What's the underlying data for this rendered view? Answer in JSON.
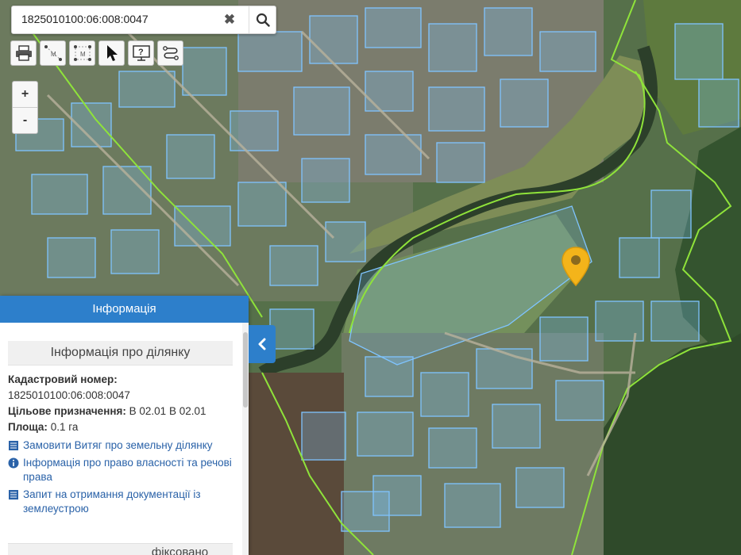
{
  "search": {
    "value": "1825010100:06:008:0047",
    "clear_label": "✖"
  },
  "zoom": {
    "in_label": "+",
    "out_label": "-"
  },
  "toolbar": {
    "measure_label": "M",
    "measure_area_label": "M"
  },
  "panel": {
    "header": "Інформація",
    "section_title": "Інформація про ділянку",
    "cadastral_label": "Кадастровий номер:",
    "cadastral_value": "1825010100:06:008:0047",
    "purpose_label": "Цільове призначення:",
    "purpose_value": "В 02.01 В 02.01",
    "area_label": "Площа:",
    "area_value": "0.1 га",
    "links": [
      "Замовити Витяг про земельну ділянку",
      "Інформація про право власності та речові права",
      "Запит на отримання документації із землеустрою"
    ],
    "next_section_partial": "фіксовано"
  },
  "colors": {
    "accent": "#2d7fcb",
    "marker": "#f4b41a",
    "boundary": "#8fe33a",
    "parcels": "#7fc4ff"
  }
}
